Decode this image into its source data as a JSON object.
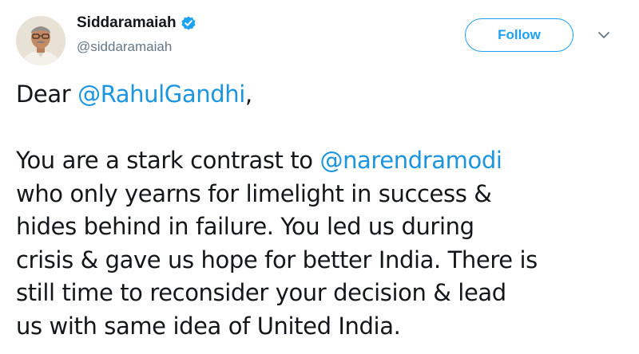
{
  "author": {
    "display_name": "Siddaramaiah",
    "handle": "@siddaramaiah",
    "verified": true,
    "avatar_icon": "profile-photo"
  },
  "actions": {
    "follow_label": "Follow",
    "menu_icon": "chevron-down-icon"
  },
  "tweet": {
    "greeting_prefix": "Dear ",
    "mention_1": "@RahulGandhi",
    "greeting_suffix": ",",
    "line_1_prefix": "You are a stark contrast to ",
    "mention_2": "@narendramodi",
    "line_2": "who only yearns for limelight in success &",
    "line_3": "hides behind in failure. You led us during",
    "line_4": "crisis & gave us hope for better India. There is",
    "line_5": "still time to reconsider your decision & lead",
    "line_6": "us with same idea of United India."
  },
  "colors": {
    "accent": "#1da1f2",
    "mention": "#1b95e0",
    "text": "#14171a",
    "secondary_text": "#657786"
  }
}
